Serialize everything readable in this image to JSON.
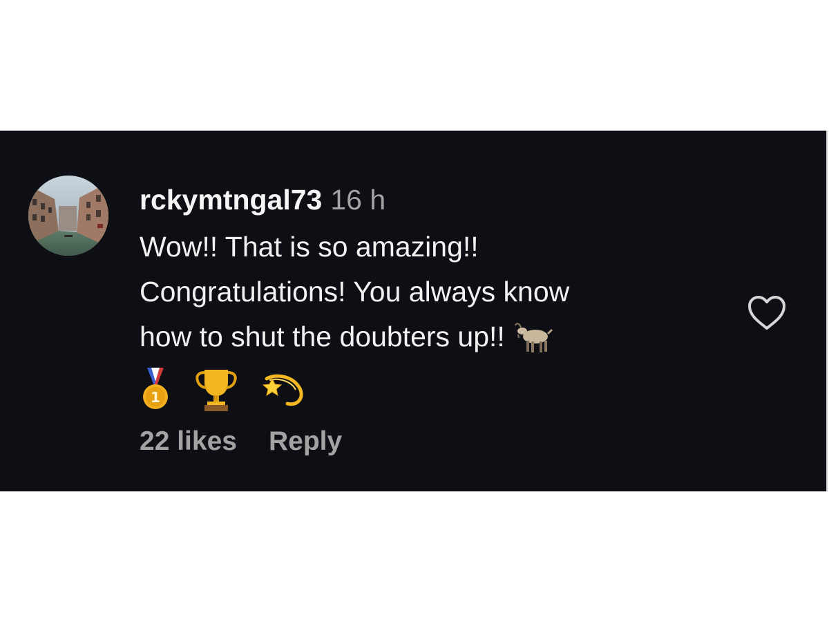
{
  "comment": {
    "username": "rckymtngal73",
    "timestamp": "16 h",
    "text_lines": [
      "Wow!! That is so amazing!!",
      "Congratulations! You always know",
      "how to shut the doubters up!!"
    ],
    "emojis": [
      "goat",
      "first-place-medal",
      "trophy",
      "dizzy-star"
    ],
    "likes": "22 likes",
    "reply_label": "Reply"
  },
  "colors": {
    "background": "#0d0f14",
    "text_primary": "#f2f2f2",
    "text_secondary": "#a3a3a3"
  },
  "icons": {
    "like": "heart-outline-icon"
  }
}
